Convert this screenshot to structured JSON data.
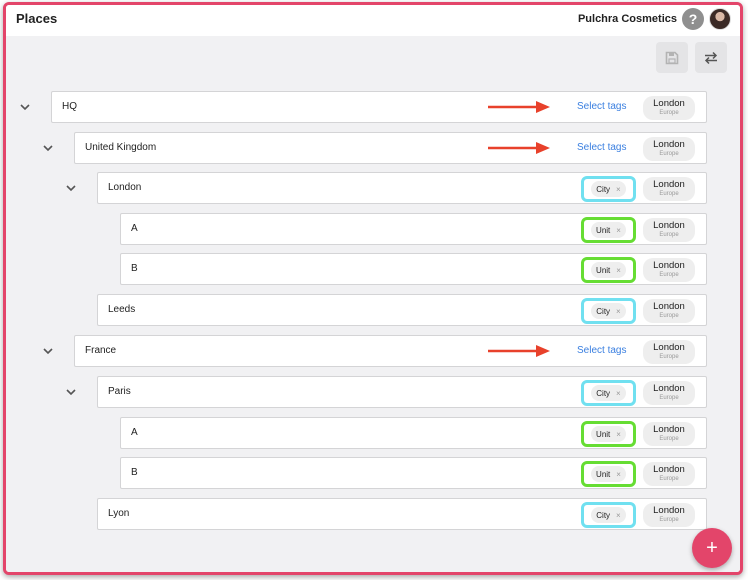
{
  "header": {
    "title": "Places",
    "org_name": "Pulchra Cosmetics",
    "help_label": "?"
  },
  "toolbar": {
    "save_icon": "save-icon",
    "swap_icon": "swap-icon"
  },
  "tree": [
    {
      "name": "HQ",
      "tag": null,
      "select_tags_label": "Select tags",
      "location": {
        "city": "London",
        "region": "Europe"
      }
    },
    {
      "name": "United Kingdom",
      "tag": null,
      "select_tags_label": "Select tags",
      "location": {
        "city": "London",
        "region": "Europe"
      }
    },
    {
      "name": "London",
      "tag": "City",
      "location": {
        "city": "London",
        "region": "Europe"
      }
    },
    {
      "name": "A",
      "tag": "Unit",
      "location": {
        "city": "London",
        "region": "Europe"
      }
    },
    {
      "name": "B",
      "tag": "Unit",
      "location": {
        "city": "London",
        "region": "Europe"
      }
    },
    {
      "name": "Leeds",
      "tag": "City",
      "location": {
        "city": "London",
        "region": "Europe"
      }
    },
    {
      "name": "France",
      "tag": null,
      "select_tags_label": "Select tags",
      "location": {
        "city": "London",
        "region": "Europe"
      }
    },
    {
      "name": "Paris",
      "tag": "City",
      "location": {
        "city": "London",
        "region": "Europe"
      }
    },
    {
      "name": "A",
      "tag": "Unit",
      "location": {
        "city": "London",
        "region": "Europe"
      }
    },
    {
      "name": "B",
      "tag": "Unit",
      "location": {
        "city": "London",
        "region": "Europe"
      }
    },
    {
      "name": "Lyon",
      "tag": "City",
      "location": {
        "city": "London",
        "region": "Europe"
      }
    }
  ],
  "tag_remove_glyph": "×",
  "fab_label": "+",
  "colors": {
    "accent": "#e3456a",
    "link": "#3a7fe0",
    "city_highlight": "#70e0f0",
    "unit_highlight": "#66dd33",
    "annotation_arrow": "#e8412b"
  }
}
